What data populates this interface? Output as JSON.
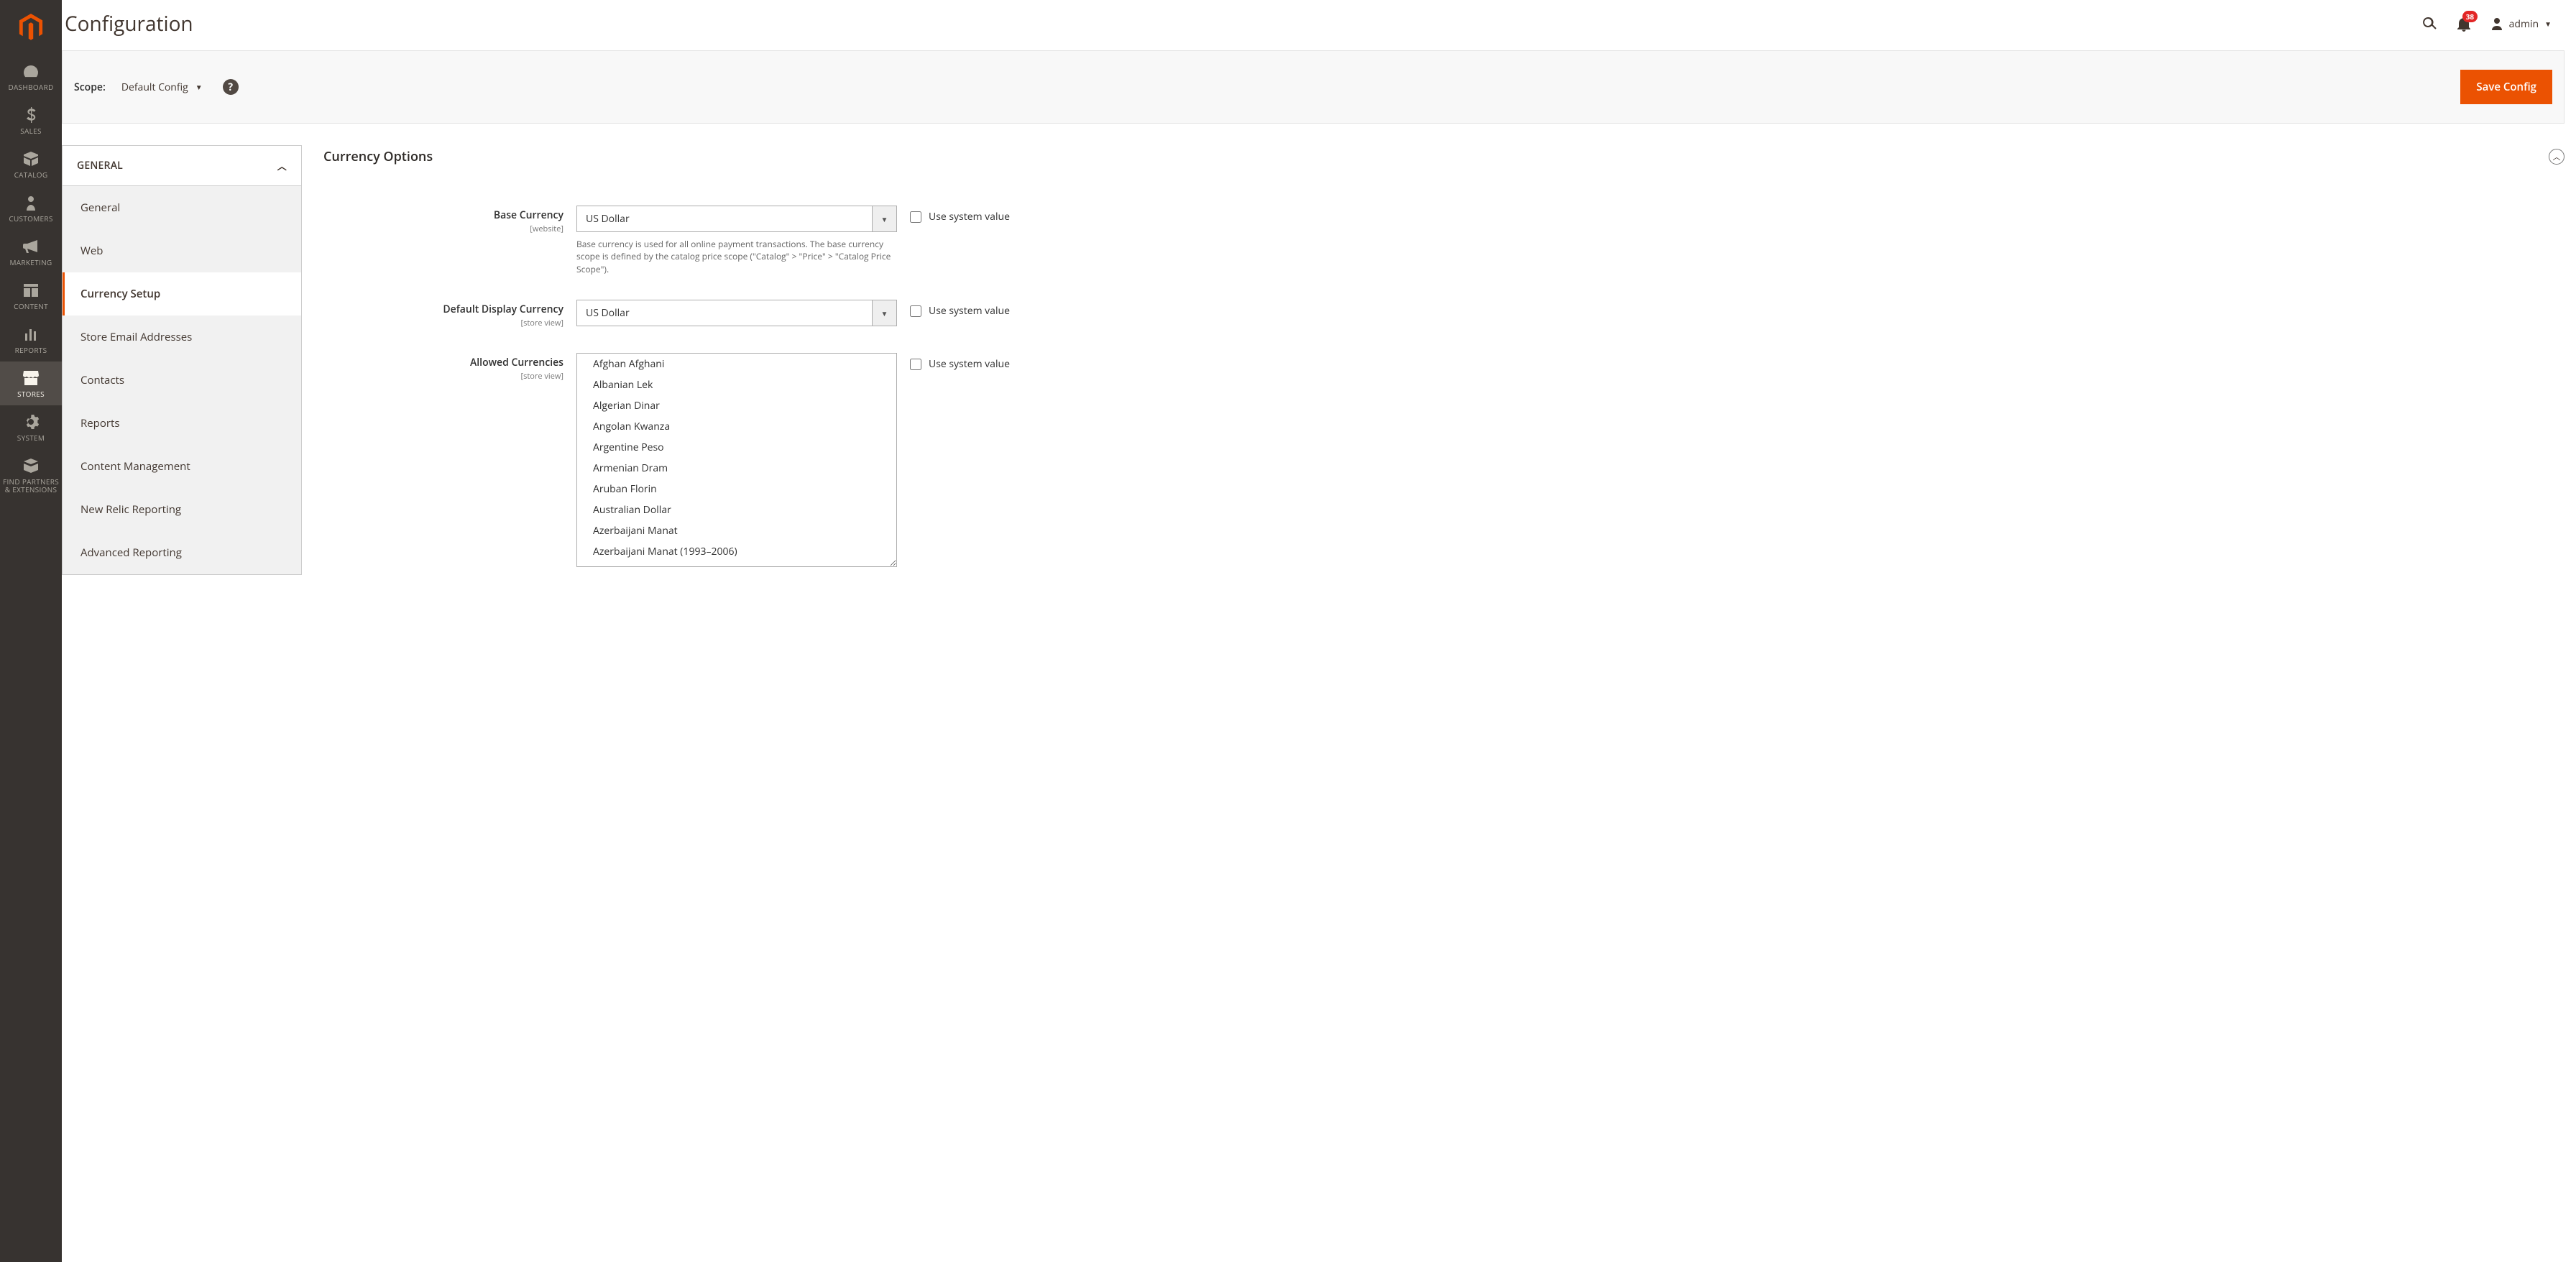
{
  "header": {
    "title": "Configuration",
    "notification_count": "38",
    "admin_user": "admin"
  },
  "scope": {
    "label": "Scope:",
    "value": "Default Config",
    "save_button": "Save Config"
  },
  "sidebar": {
    "items": [
      {
        "label": "DASHBOARD"
      },
      {
        "label": "SALES"
      },
      {
        "label": "CATALOG"
      },
      {
        "label": "CUSTOMERS"
      },
      {
        "label": "MARKETING"
      },
      {
        "label": "CONTENT"
      },
      {
        "label": "REPORTS"
      },
      {
        "label": "STORES"
      },
      {
        "label": "SYSTEM"
      },
      {
        "label": "FIND PARTNERS & EXTENSIONS"
      }
    ]
  },
  "config_tabs": {
    "head": "GENERAL",
    "items": [
      {
        "label": "General"
      },
      {
        "label": "Web"
      },
      {
        "label": "Currency Setup"
      },
      {
        "label": "Store Email Addresses"
      },
      {
        "label": "Contacts"
      },
      {
        "label": "Reports"
      },
      {
        "label": "Content Management"
      },
      {
        "label": "New Relic Reporting"
      },
      {
        "label": "Advanced Reporting"
      }
    ]
  },
  "section": {
    "title": "Currency Options",
    "use_system_value_label": "Use system value",
    "fields": {
      "base_currency": {
        "title": "Base Currency",
        "scope": "[website]",
        "value": "US Dollar",
        "note": "Base currency is used for all online payment transactions. The base currency scope is defined by the catalog price scope (\"Catalog\" > \"Price\" > \"Catalog Price Scope\")."
      },
      "default_display_currency": {
        "title": "Default Display Currency",
        "scope": "[store view]",
        "value": "US Dollar"
      },
      "allowed_currencies": {
        "title": "Allowed Currencies",
        "scope": "[store view]",
        "options": [
          "Afghan Afghani",
          "Albanian Lek",
          "Algerian Dinar",
          "Angolan Kwanza",
          "Argentine Peso",
          "Armenian Dram",
          "Aruban Florin",
          "Australian Dollar",
          "Azerbaijani Manat",
          "Azerbaijani Manat (1993–2006)"
        ]
      }
    }
  }
}
